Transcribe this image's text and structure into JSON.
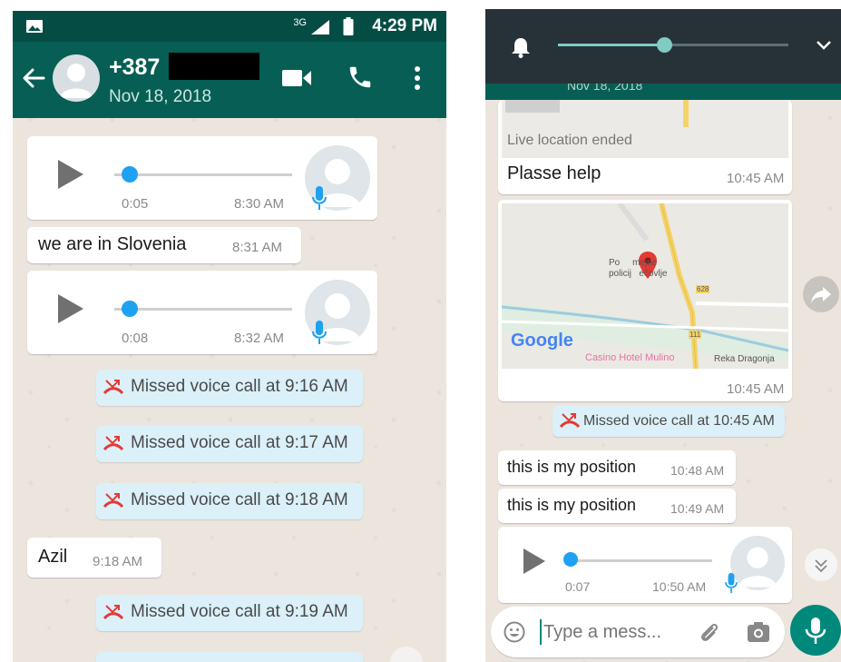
{
  "left": {
    "status": {
      "network": "3G",
      "time": "4:29 PM"
    },
    "header": {
      "contact": "+387",
      "subtitle": "Nov 18, 2018"
    },
    "messages": {
      "voice1": {
        "duration": "0:05",
        "time": "8:30 AM"
      },
      "text1": {
        "text": "we are in Slovenia",
        "time": "8:31 AM"
      },
      "voice2": {
        "duration": "0:08",
        "time": "8:32 AM"
      },
      "missed1": "Missed voice call at 9:16 AM",
      "missed2": "Missed voice call at 9:17 AM",
      "missed3": "Missed voice call at 9:18 AM",
      "text2": {
        "text": "Azil",
        "time": "9:18 AM"
      },
      "missed4": "Missed voice call at 9:19 AM"
    }
  },
  "right": {
    "header_partial": "Nov 18, 2018",
    "live_location": "Live location ended",
    "text1": {
      "text": "Plasse help",
      "time": "10:45 AM"
    },
    "map": {
      "logo": "Google",
      "place": "Po     mejne\npolicij   ečovlje",
      "road": "628",
      "road2": "111",
      "poi": "Casino Hotel Mulino",
      "river": "Reka Dragonja",
      "time": "10:45 AM"
    },
    "missed": "Missed voice call at 10:45 AM",
    "text2": {
      "text": "this is my position",
      "time": "10:48 AM"
    },
    "text3": {
      "text": "this is my position",
      "time": "10:49 AM"
    },
    "voice": {
      "duration": "0:07",
      "time": "10:50 AM"
    },
    "input": {
      "placeholder": "Type a mess..."
    }
  },
  "colors": {
    "header": "#075e54",
    "statusbar": "#054d44",
    "accent": "#00897b",
    "chat_bg": "#ece5dd",
    "system_bubble": "#dbf0f8",
    "missed_icon": "#e53935",
    "play_knob": "#1ea1f1"
  },
  "icons": [
    "image-icon",
    "signal-icon",
    "battery-icon",
    "back-arrow-icon",
    "video-call-icon",
    "phone-icon",
    "more-vert-icon",
    "play-icon",
    "mic-icon",
    "missed-call-icon",
    "bell-icon",
    "chevron-down-icon",
    "forward-icon",
    "scroll-down-icon",
    "emoji-icon",
    "attach-icon",
    "camera-icon",
    "map-pin-icon"
  ]
}
